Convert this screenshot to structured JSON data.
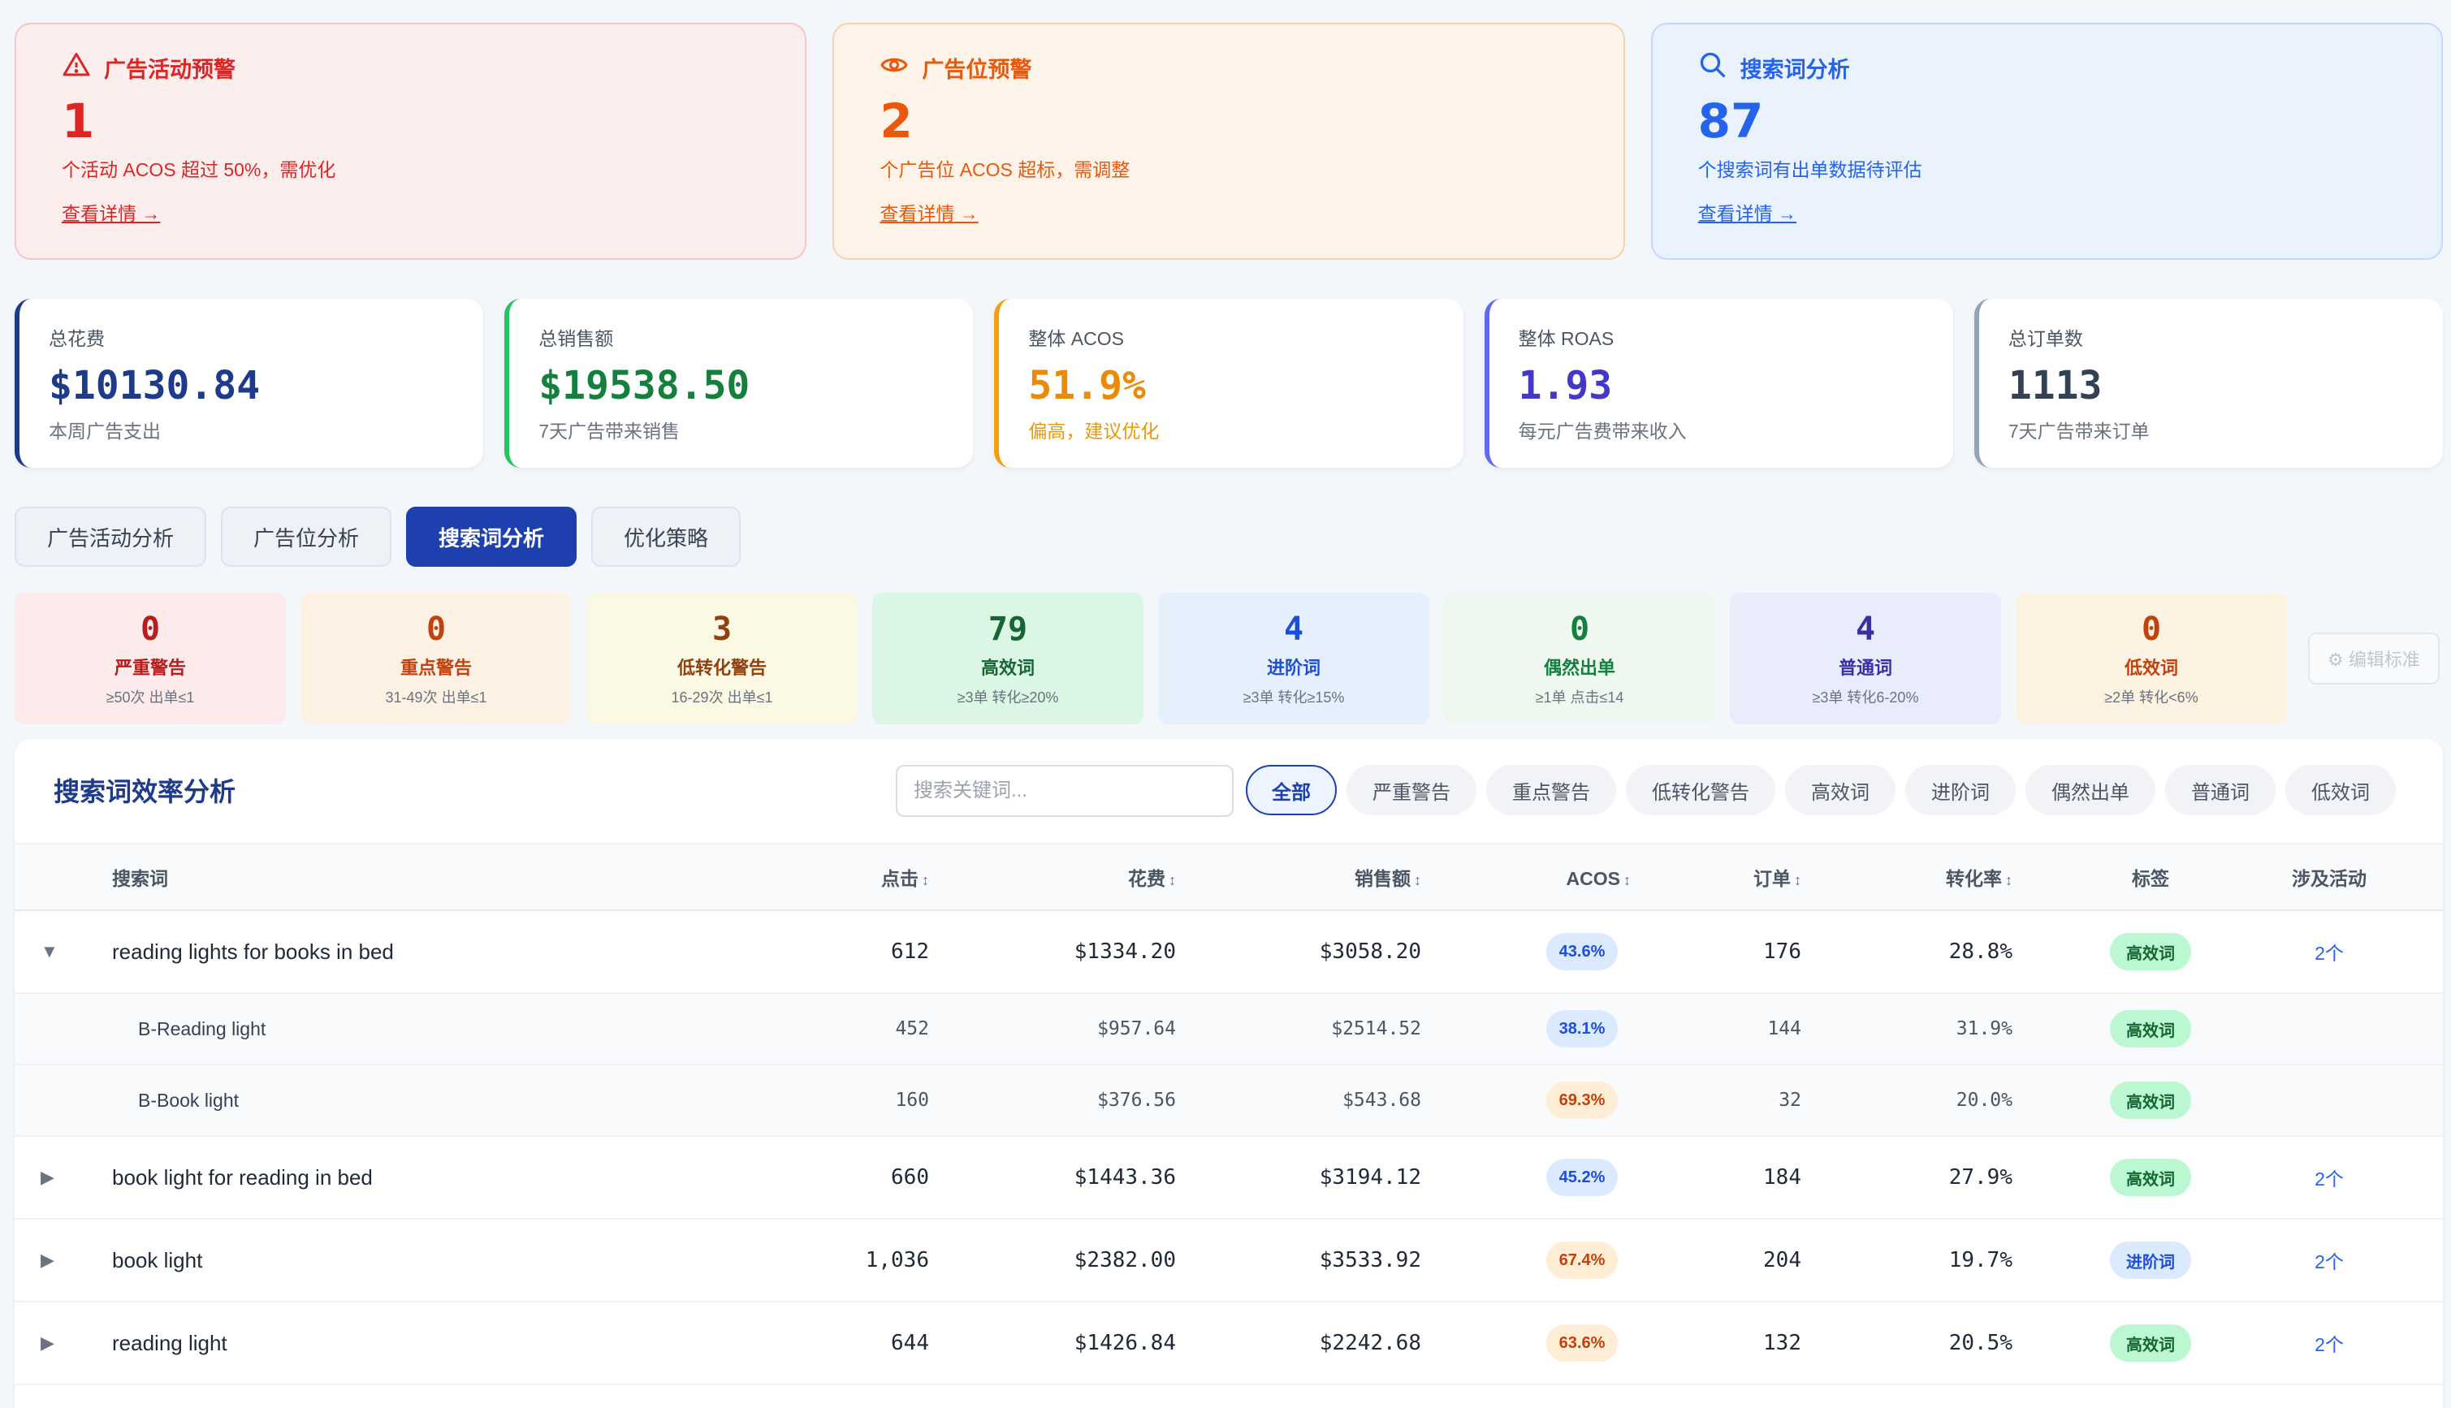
{
  "alerts": [
    {
      "title": "广告活动预警",
      "icon": "warning-triangle-icon",
      "count": "1",
      "desc": "个活动 ACOS 超过 50%，需优化",
      "link": "查看详情 →",
      "color": "#dc2626"
    },
    {
      "title": "广告位预警",
      "icon": "eye-icon",
      "count": "2",
      "desc": "个广告位 ACOS 超标，需调整",
      "link": "查看详情 →",
      "color": "#ea580c"
    },
    {
      "title": "搜索词分析",
      "icon": "search-icon",
      "count": "87",
      "desc": "个搜索词有出单数据待评估",
      "link": "查看详情 →",
      "color": "#2563eb"
    }
  ],
  "kpis": [
    {
      "label": "总花费",
      "value": "$10130.84",
      "sub": "本周广告支出"
    },
    {
      "label": "总销售额",
      "value": "$19538.50",
      "sub": "7天广告带来销售"
    },
    {
      "label": "整体 ACOS",
      "value": "51.9%",
      "sub": "偏高，建议优化"
    },
    {
      "label": "整体 ROAS",
      "value": "1.93",
      "sub": "每元广告费带来收入"
    },
    {
      "label": "总订单数",
      "value": "1113",
      "sub": "7天广告带来订单"
    }
  ],
  "tabs": [
    "广告活动分析",
    "广告位分析",
    "搜索词分析",
    "优化策略"
  ],
  "categories": [
    {
      "count": "0",
      "name": "严重警告",
      "rule": "≥50次 出单≤1"
    },
    {
      "count": "0",
      "name": "重点警告",
      "rule": "31-49次 出单≤1"
    },
    {
      "count": "3",
      "name": "低转化警告",
      "rule": "16-29次 出单≤1"
    },
    {
      "count": "79",
      "name": "高效词",
      "rule": "≥3单 转化≥20%"
    },
    {
      "count": "4",
      "name": "进阶词",
      "rule": "≥3单 转化≥15%"
    },
    {
      "count": "0",
      "name": "偶然出单",
      "rule": "≥1单 点击≤14"
    },
    {
      "count": "4",
      "name": "普通词",
      "rule": "≥3单 转化6-20%"
    },
    {
      "count": "0",
      "name": "低效词",
      "rule": "≥2单 转化<6%"
    }
  ],
  "edit_standard": "⚙ 编辑标准",
  "panel": {
    "title": "搜索词效率分析",
    "search_placeholder": "搜索关键词...",
    "filters": [
      "全部",
      "严重警告",
      "重点警告",
      "低转化警告",
      "高效词",
      "进阶词",
      "偶然出单",
      "普通词",
      "低效词"
    ]
  },
  "table": {
    "headers": {
      "term": "搜索词",
      "clicks": "点击",
      "spend": "花费",
      "sales": "销售额",
      "acos": "ACOS",
      "orders": "订单",
      "cvr": "转化率",
      "tag": "标签",
      "campaigns": "涉及活动"
    },
    "sort_icon": "↕",
    "rows": [
      {
        "toggle": "▼",
        "term": "reading lights for books in bed",
        "clicks": "612",
        "spend": "$1334.20",
        "sales": "$3058.20",
        "acos": "43.6%",
        "orders": "176",
        "cvr": "28.8%",
        "tag": "高效词",
        "campaigns": "2个"
      },
      {
        "term": "B-Reading light",
        "clicks": "452",
        "spend": "$957.64",
        "sales": "$2514.52",
        "acos": "38.1%",
        "orders": "144",
        "cvr": "31.9%",
        "tag": "高效词"
      },
      {
        "term": "B-Book light",
        "clicks": "160",
        "spend": "$376.56",
        "sales": "$543.68",
        "acos": "69.3%",
        "orders": "32",
        "cvr": "20.0%",
        "tag": "高效词"
      },
      {
        "toggle": "▶",
        "term": "book light for reading in bed",
        "clicks": "660",
        "spend": "$1443.36",
        "sales": "$3194.12",
        "acos": "45.2%",
        "orders": "184",
        "cvr": "27.9%",
        "tag": "高效词",
        "campaigns": "2个"
      },
      {
        "toggle": "▶",
        "term": "book light",
        "clicks": "1,036",
        "spend": "$2382.00",
        "sales": "$3533.92",
        "acos": "67.4%",
        "orders": "204",
        "cvr": "19.7%",
        "tag": "进阶词",
        "campaigns": "2个"
      },
      {
        "toggle": "▶",
        "term": "reading light",
        "clicks": "644",
        "spend": "$1426.84",
        "sales": "$2242.68",
        "acos": "63.6%",
        "orders": "132",
        "cvr": "20.5%",
        "tag": "高效词",
        "campaigns": "2个"
      }
    ]
  },
  "colors": {
    "primary": "#1e40af",
    "danger": "#dc2626",
    "warning": "#ea580c",
    "info": "#2563eb",
    "success": "#15803d"
  }
}
